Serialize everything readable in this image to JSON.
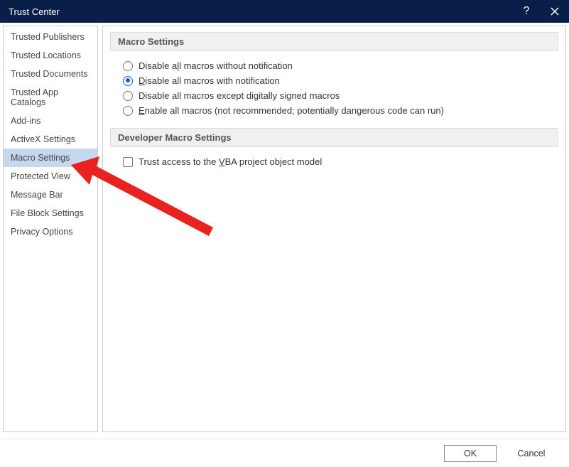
{
  "window": {
    "title": "Trust Center"
  },
  "sidebar": {
    "items": [
      {
        "label": "Trusted Publishers",
        "selected": false
      },
      {
        "label": "Trusted Locations",
        "selected": false
      },
      {
        "label": "Trusted Documents",
        "selected": false
      },
      {
        "label": "Trusted App Catalogs",
        "selected": false
      },
      {
        "label": "Add-ins",
        "selected": false
      },
      {
        "label": "ActiveX Settings",
        "selected": false
      },
      {
        "label": "Macro Settings",
        "selected": true
      },
      {
        "label": "Protected View",
        "selected": false
      },
      {
        "label": "Message Bar",
        "selected": false
      },
      {
        "label": "File Block Settings",
        "selected": false
      },
      {
        "label": "Privacy Options",
        "selected": false
      }
    ]
  },
  "sections": {
    "macro": {
      "header": "Macro Settings",
      "options": [
        {
          "label_pre": "Disable a",
          "mnemonic": "l",
          "label_post": "l macros without notification",
          "checked": false
        },
        {
          "label_pre": "",
          "mnemonic": "D",
          "label_post": "isable all macros with notification",
          "checked": true
        },
        {
          "label_pre": "Disable all macros except digitally si",
          "mnemonic": "g",
          "label_post": "ned macros",
          "checked": false
        },
        {
          "label_pre": "",
          "mnemonic": "E",
          "label_post": "nable all macros (not recommended; potentially dangerous code can run)",
          "checked": false
        }
      ]
    },
    "developer": {
      "header": "Developer Macro Settings",
      "trust_label_pre": "Trust access to the ",
      "trust_mnemonic": "V",
      "trust_label_post": "BA project object model",
      "trust_checked": false
    }
  },
  "footer": {
    "ok": "OK",
    "cancel": "Cancel"
  }
}
